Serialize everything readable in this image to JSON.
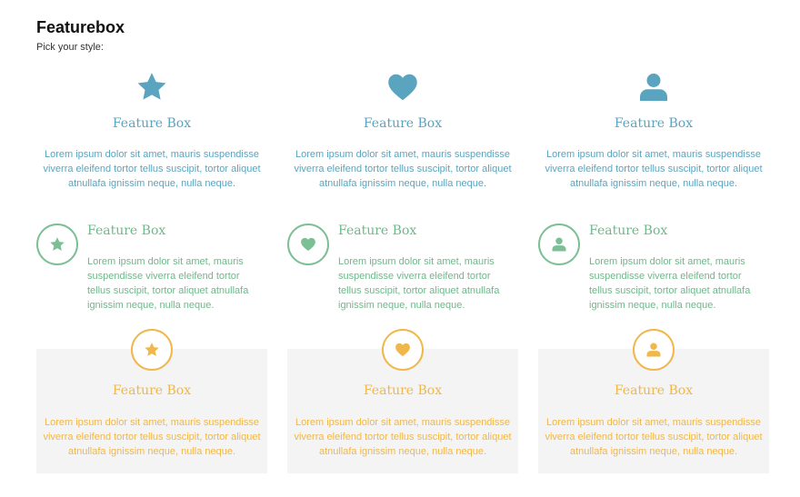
{
  "header": {
    "title": "Featurebox",
    "subtitle": "Pick your style:"
  },
  "colors": {
    "blue": "#5aa4bf",
    "green": "#6fb88a",
    "orange": "#f0b74a",
    "panel_bg": "#f4f4f4"
  },
  "style1": {
    "boxes": [
      {
        "icon": "star-icon",
        "title": "Feature Box",
        "text": "Lorem ipsum dolor sit amet, mauris suspendisse viverra eleifend tortor tellus suscipit, tortor aliquet atnullafa ignissim neque, nulla neque."
      },
      {
        "icon": "heart-icon",
        "title": "Feature Box",
        "text": "Lorem ipsum dolor sit amet, mauris suspendisse viverra eleifend tortor tellus suscipit, tortor aliquet atnullafa ignissim neque, nulla neque."
      },
      {
        "icon": "user-icon",
        "title": "Feature Box",
        "text": "Lorem ipsum dolor sit amet, mauris suspendisse viverra eleifend tortor tellus suscipit, tortor aliquet atnullafa ignissim neque, nulla neque."
      }
    ]
  },
  "style2": {
    "boxes": [
      {
        "icon": "star-icon",
        "title": "Feature Box",
        "text": "Lorem ipsum dolor sit amet, mauris suspendisse viverra eleifend tortor tellus suscipit, tortor aliquet atnullafa ignissim neque, nulla neque."
      },
      {
        "icon": "heart-icon",
        "title": "Feature Box",
        "text": "Lorem ipsum dolor sit amet, mauris suspendisse viverra eleifend tortor tellus suscipit, tortor aliquet atnullafa ignissim neque, nulla neque."
      },
      {
        "icon": "user-icon",
        "title": "Feature Box",
        "text": "Lorem ipsum dolor sit amet, mauris suspendisse viverra eleifend tortor tellus suscipit, tortor aliquet atnullafa ignissim neque, nulla neque."
      }
    ]
  },
  "style3": {
    "boxes": [
      {
        "icon": "star-icon",
        "title": "Feature Box",
        "text": "Lorem ipsum dolor sit amet, mauris suspendisse viverra eleifend tortor tellus suscipit, tortor aliquet atnullafa ignissim neque, nulla neque."
      },
      {
        "icon": "heart-icon",
        "title": "Feature Box",
        "text": "Lorem ipsum dolor sit amet, mauris suspendisse viverra eleifend tortor tellus suscipit, tortor aliquet atnullafa ignissim neque, nulla neque."
      },
      {
        "icon": "user-icon",
        "title": "Feature Box",
        "text": "Lorem ipsum dolor sit amet, mauris suspendisse viverra eleifend tortor tellus suscipit, tortor aliquet atnullafa ignissim neque, nulla neque."
      }
    ]
  }
}
